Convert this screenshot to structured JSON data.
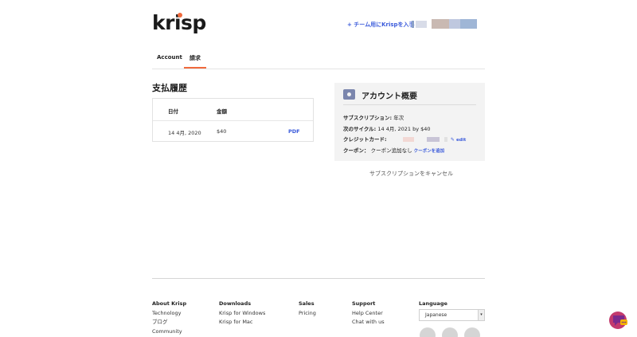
{
  "header": {
    "logo_text": "krisp",
    "team_link": "+ チーム用にKrispを入手",
    "colors": {
      "accent": "#f06a3d",
      "link": "#3b5bdb"
    }
  },
  "tabs": [
    {
      "label": "Account",
      "active": false
    },
    {
      "label": "請求",
      "active": true
    }
  ],
  "history": {
    "title": "支払履歴",
    "columns": [
      "日付",
      "金額"
    ],
    "rows": [
      {
        "date": "14 4月, 2020",
        "amount": "$40",
        "action": "PDF"
      }
    ]
  },
  "summary": {
    "title": "アカウント概要",
    "subscription_label": "サブスクリプション:",
    "subscription_value": "年次",
    "next_cycle_label": "次のサイクル:",
    "next_cycle_value": "14 4月, 2021 by $40",
    "card_label": "クレジットカード:",
    "card_edit": "edit",
    "coupon_label": "クーポン：",
    "coupon_value": "クーポン追加なし",
    "coupon_add": "クーポンを追加"
  },
  "cancel_link": "サブスクリプションをキャンセル",
  "footer": {
    "columns": [
      {
        "heading": "About Krisp",
        "items": [
          "Technology",
          "ブログ",
          "Community"
        ]
      },
      {
        "heading": "Downloads",
        "items": [
          "Krisp for Windows",
          "Krisp for Mac"
        ]
      },
      {
        "heading": "Sales",
        "items": [
          "Pricing"
        ]
      },
      {
        "heading": "Support",
        "items": [
          "Help Center",
          "Chat with us"
        ]
      }
    ],
    "language_heading": "Language",
    "language_value": "Japanese",
    "social_icons": [
      "twitter-icon",
      "linkedin-icon",
      "facebook-icon"
    ]
  }
}
